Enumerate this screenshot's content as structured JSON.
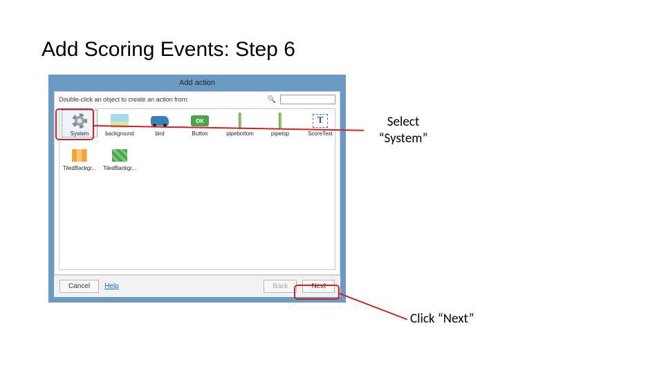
{
  "slide": {
    "title": "Add Scoring Events: Step 6"
  },
  "dialog": {
    "title": "Add action",
    "instruction": "Double-click an object to create an action from:",
    "search_placeholder": "",
    "objects": {
      "system": "System",
      "background": "background",
      "bird": "bird",
      "button": "Button",
      "pipebottom": "pipebottom",
      "pipetop": "pipetop",
      "scoretext": "ScoreText",
      "tiled1": "TiledBackgr...",
      "tiled2": "TiledBackgr..."
    },
    "ok_glyph": "OK",
    "text_glyph": "T",
    "footer": {
      "cancel": "Cancel",
      "help": "Help",
      "back": "Back",
      "next": "Next"
    }
  },
  "annotations": {
    "select_system": "Select “System”",
    "click_next": "Click “Next”"
  }
}
